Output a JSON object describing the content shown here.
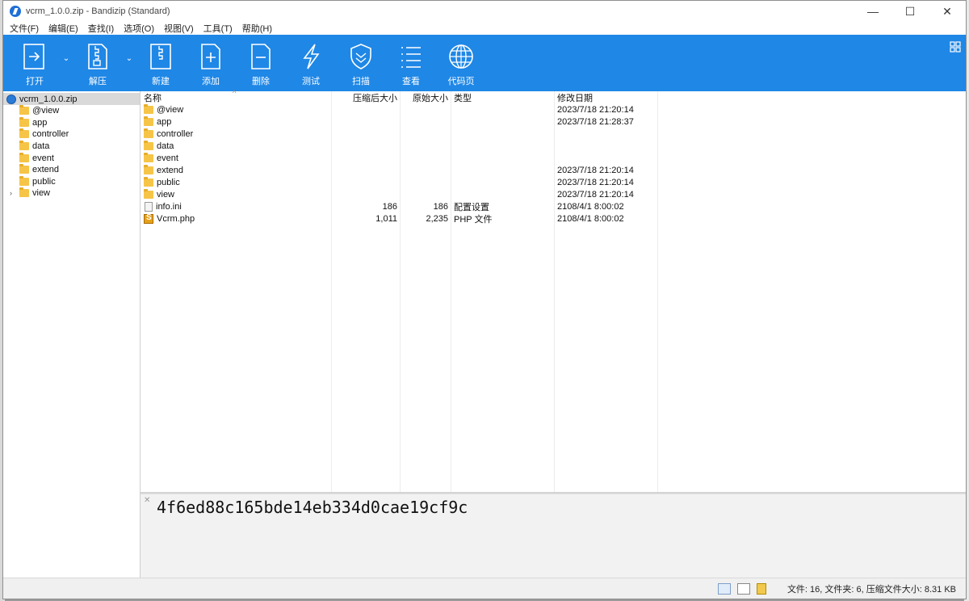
{
  "window": {
    "title": "vcrm_1.0.0.zip - Bandizip (Standard)",
    "controls": {
      "minimize": "—",
      "maximize": "☐",
      "close": "✕"
    }
  },
  "menu": [
    "文件(F)",
    "编辑(E)",
    "查找(I)",
    "选项(O)",
    "视图(V)",
    "工具(T)",
    "帮助(H)"
  ],
  "toolbar": {
    "buttons": [
      {
        "label": "打开",
        "icon": "open-icon"
      },
      {
        "label": "解压",
        "icon": "extract-icon"
      },
      {
        "label": "新建",
        "icon": "new-archive-icon"
      },
      {
        "label": "添加",
        "icon": "add-file-icon"
      },
      {
        "label": "删除",
        "icon": "delete-file-icon"
      },
      {
        "label": "测试",
        "icon": "test-icon"
      },
      {
        "label": "扫描",
        "icon": "scan-shield-icon"
      },
      {
        "label": "查看",
        "icon": "view-list-icon"
      },
      {
        "label": "代码页",
        "icon": "codepage-globe-icon"
      }
    ],
    "accent": "#1f87e6"
  },
  "tree": {
    "root": "vcrm_1.0.0.zip",
    "items": [
      "@view",
      "app",
      "controller",
      "data",
      "event",
      "extend",
      "public",
      "view"
    ]
  },
  "list": {
    "headers": {
      "name": "名称",
      "compressed": "压缩后大小",
      "original": "原始大小",
      "type": "类型",
      "modified": "修改日期"
    },
    "rows": [
      {
        "name": "@view",
        "kind": "folder",
        "compressed": "",
        "original": "",
        "type": "",
        "modified": "2023/7/18 21:20:14"
      },
      {
        "name": "app",
        "kind": "folder",
        "compressed": "",
        "original": "",
        "type": "",
        "modified": "2023/7/18 21:28:37"
      },
      {
        "name": "controller",
        "kind": "folder",
        "compressed": "",
        "original": "",
        "type": "",
        "modified": ""
      },
      {
        "name": "data",
        "kind": "folder",
        "compressed": "",
        "original": "",
        "type": "",
        "modified": ""
      },
      {
        "name": "event",
        "kind": "folder",
        "compressed": "",
        "original": "",
        "type": "",
        "modified": ""
      },
      {
        "name": "extend",
        "kind": "folder",
        "compressed": "",
        "original": "",
        "type": "",
        "modified": "2023/7/18 21:20:14"
      },
      {
        "name": "public",
        "kind": "folder",
        "compressed": "",
        "original": "",
        "type": "",
        "modified": "2023/7/18 21:20:14"
      },
      {
        "name": "view",
        "kind": "folder",
        "compressed": "",
        "original": "",
        "type": "",
        "modified": "2023/7/18 21:20:14"
      },
      {
        "name": "info.ini",
        "kind": "ini",
        "compressed": "186",
        "original": "186",
        "type": "配置设置",
        "modified": "2108/4/1 8:00:02"
      },
      {
        "name": "Vcrm.php",
        "kind": "php",
        "compressed": "1,011",
        "original": "2,235",
        "type": "PHP 文件",
        "modified": "2108/4/1 8:00:02"
      }
    ]
  },
  "preview": {
    "close": "✕",
    "text": "4f6ed88c165bde14eb334d0cae19cf9c"
  },
  "status": {
    "text": "文件: 16, 文件夹: 6, 压缩文件大小: 8.31 KB"
  }
}
